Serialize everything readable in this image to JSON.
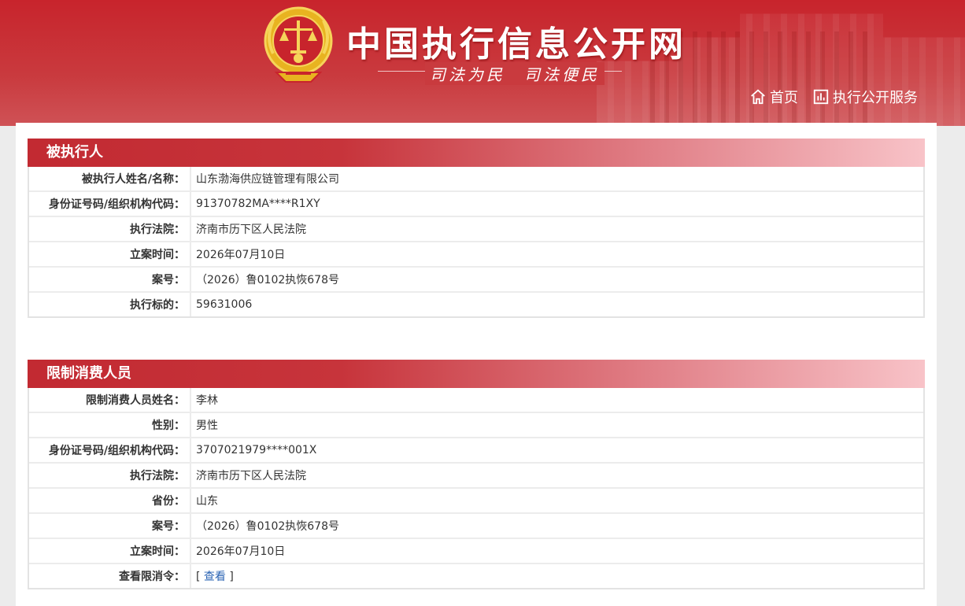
{
  "header": {
    "site_title": "中国执行信息公开网",
    "slogan": "司法为民　司法便民",
    "nav": {
      "home_label": "首页",
      "service_label": "执行公开服务"
    }
  },
  "sections": [
    {
      "title": "被执行人",
      "rows": [
        {
          "label": "被执行人姓名/名称：",
          "value": "山东渤海供应链管理有限公司"
        },
        {
          "label": "身份证号码/组织机构代码：",
          "value": "91370782MA****R1XY"
        },
        {
          "label": "执行法院：",
          "value": "济南市历下区人民法院"
        },
        {
          "label": "立案时间：",
          "value": "2026年07月10日"
        },
        {
          "label": "案号：",
          "value": "（2026）鲁0102执恢678号"
        },
        {
          "label": "执行标的：",
          "value": "59631006"
        }
      ]
    },
    {
      "title": "限制消费人员",
      "rows": [
        {
          "label": "限制消费人员姓名：",
          "value": "李林"
        },
        {
          "label": "性别：",
          "value": "男性"
        },
        {
          "label": "身份证号码/组织机构代码：",
          "value": "3707021979****001X"
        },
        {
          "label": "执行法院：",
          "value": "济南市历下区人民法院"
        },
        {
          "label": "省份：",
          "value": "山东"
        },
        {
          "label": "案号：",
          "value": "（2026）鲁0102执恢678号"
        },
        {
          "label": "立案时间：",
          "value": "2026年07月10日"
        },
        {
          "label": "查看限消令：",
          "value_prefix": "[ ",
          "link_text": "查看",
          "value_suffix": " ]"
        }
      ]
    }
  ],
  "colors": {
    "header_red": "#c8242c",
    "section_head_start": "#c22a32",
    "section_head_end": "#f8c3c8",
    "link_blue": "#2a63b3"
  },
  "icons": [
    "court-emblem-icon",
    "home-icon",
    "chart-icon"
  ]
}
